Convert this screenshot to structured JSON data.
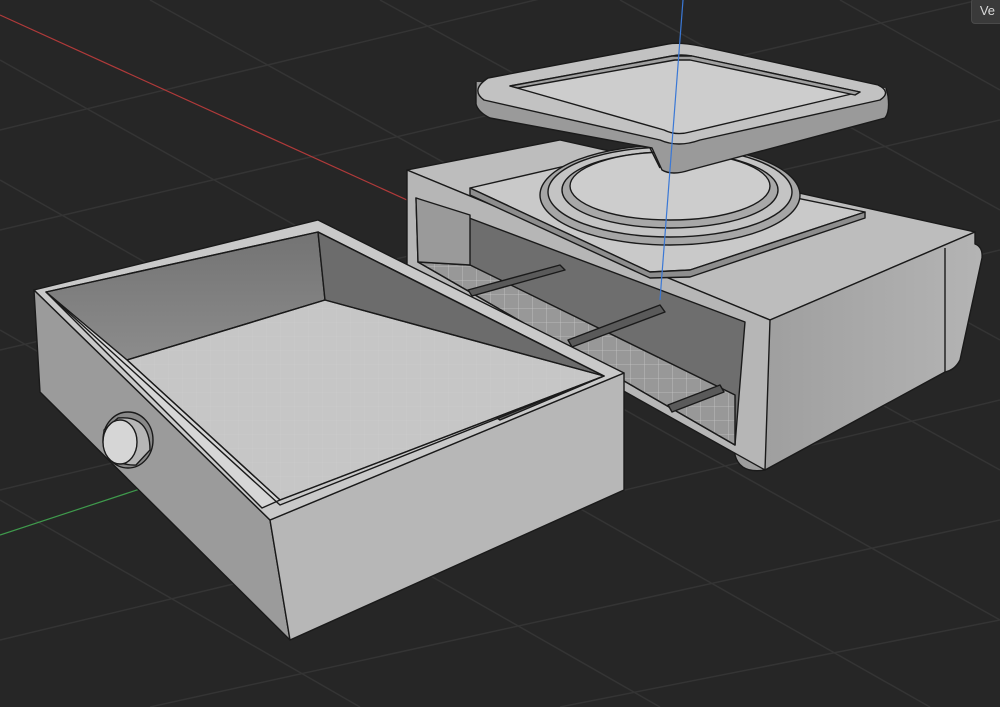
{
  "viewport": {
    "view_label": "Ve",
    "background_color": "#262626",
    "grid_color": "#303030",
    "axes": {
      "x_color": "#b03a3a",
      "y_color": "#3f9a4c",
      "z_color": "#3a78d6"
    },
    "model_parts": [
      {
        "name": "drawer",
        "has_knob": true
      },
      {
        "name": "drawer-housing"
      },
      {
        "name": "lid"
      }
    ]
  }
}
